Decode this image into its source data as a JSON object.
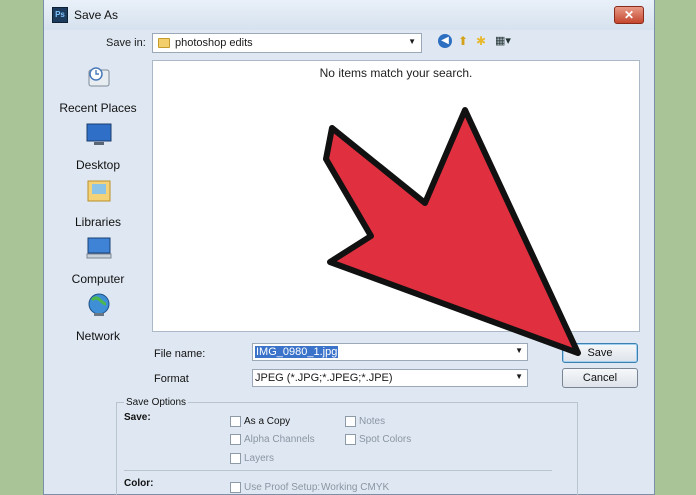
{
  "window": {
    "title": "Save As",
    "app_icon": "Ps",
    "close_label": "✕"
  },
  "toolbar": {
    "save_in_label": "Save in:",
    "save_in_value": "photoshop edits",
    "icons": [
      "back-icon",
      "up-folder-icon",
      "new-folder-icon",
      "views-menu-icon"
    ]
  },
  "places": [
    {
      "label": "Recent Places",
      "icon": "recent-places-icon"
    },
    {
      "label": "Desktop",
      "icon": "desktop-icon"
    },
    {
      "label": "Libraries",
      "icon": "libraries-icon"
    },
    {
      "label": "Computer",
      "icon": "computer-icon"
    },
    {
      "label": "Network",
      "icon": "network-icon"
    }
  ],
  "filelist": {
    "empty_message": "No items match your search."
  },
  "form": {
    "filename_label": "File name:",
    "filename_value": "IMG_0980_1.jpg",
    "format_label": "Format",
    "format_value": "JPEG (*.JPG;*.JPEG;*.JPE)",
    "save_button": "Save",
    "cancel_button": "Cancel"
  },
  "save_options": {
    "title": "Save Options",
    "save_label": "Save:",
    "color_label": "Color:",
    "checkboxes": {
      "as_a_copy": "As a Copy",
      "alpha_channels": "Alpha Channels",
      "layers": "Layers",
      "notes": "Notes",
      "spot_colors": "Spot Colors",
      "use_proof_setup": "Use Proof Setup:",
      "proof_value": "Working CMYK"
    }
  },
  "annotation": {
    "arrow_color": "#e0303f",
    "outline_color": "#111111"
  }
}
